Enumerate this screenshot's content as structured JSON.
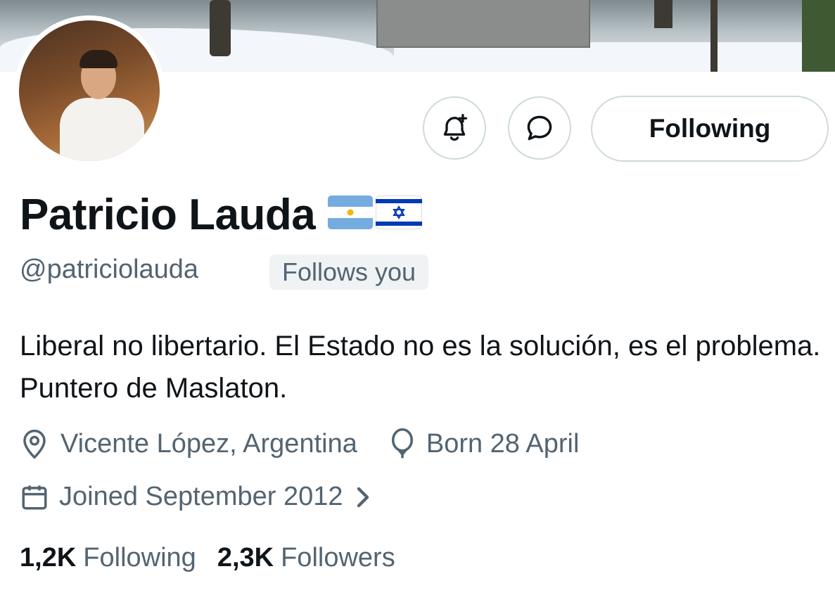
{
  "profile": {
    "display_name": "Patricio Lauda",
    "flags": [
      "argentina-flag",
      "israel-flag"
    ],
    "handle": "@patriciolauda",
    "follows_you": "Follows you",
    "bio": "Liberal no libertario. El Estado no es la solución, es el problema. Puntero de Maslaton.",
    "location": "Vicente López, Argentina",
    "birthday": "Born 28 April",
    "joined": "Joined September 2012",
    "following_count": "1,2K",
    "following_label": "Following",
    "followers_count": "2,3K",
    "followers_label": "Followers"
  },
  "actions": {
    "notifications_icon": "bell-plus-icon",
    "message_icon": "message-bubble-icon",
    "following_button": "Following"
  },
  "colors": {
    "text_primary": "#0f1419",
    "text_secondary": "#536471",
    "border": "#cfd9de",
    "badge_bg": "#eff3f4"
  }
}
